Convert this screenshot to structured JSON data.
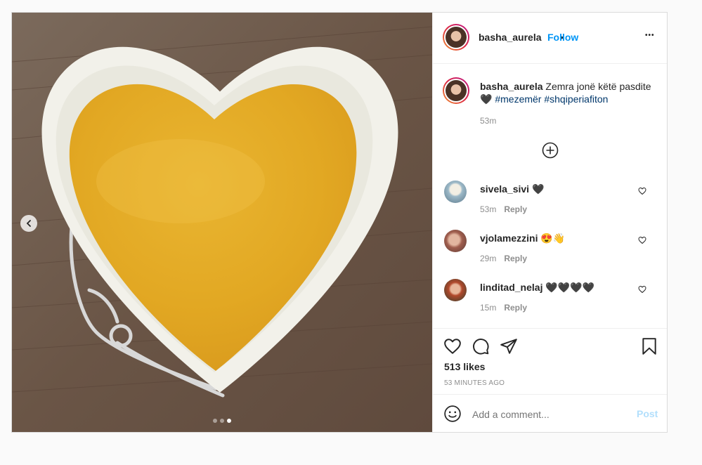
{
  "post": {
    "author": "basha_aurela",
    "follow_label": "Follow",
    "separator": "•",
    "more_label": "•••",
    "caption_text": "Zemra jonë këtë pasdite",
    "caption_heart": "🖤",
    "hashtags": [
      "#mezemër",
      "#shqiperiafiton"
    ],
    "caption_time": "53m",
    "likes": "513 likes",
    "posted": "53 MINUTES AGO",
    "carousel": {
      "count": 3,
      "active_index": 2
    }
  },
  "comments": [
    {
      "user": "sivela_sivi",
      "text": "🖤",
      "time": "53m",
      "reply": "Reply"
    },
    {
      "user": "vjolamezzini",
      "text": "😍👋",
      "time": "29m",
      "reply": "Reply"
    },
    {
      "user": "linditad_nelaj",
      "text": "🖤🖤🖤🖤",
      "time": "15m",
      "reply": "Reply"
    }
  ],
  "add_comment": {
    "placeholder": "Add a comment...",
    "post_label": "Post"
  },
  "colors": {
    "follow": "#0095f6",
    "hashtag": "#00376b",
    "post_disabled": "#b2dffc",
    "muted": "#8e8e8e"
  },
  "icons": [
    "chevron-left-icon",
    "more-icon",
    "add-circle-icon",
    "heart-icon",
    "comment-icon",
    "share-icon",
    "bookmark-icon",
    "emoji-icon"
  ]
}
